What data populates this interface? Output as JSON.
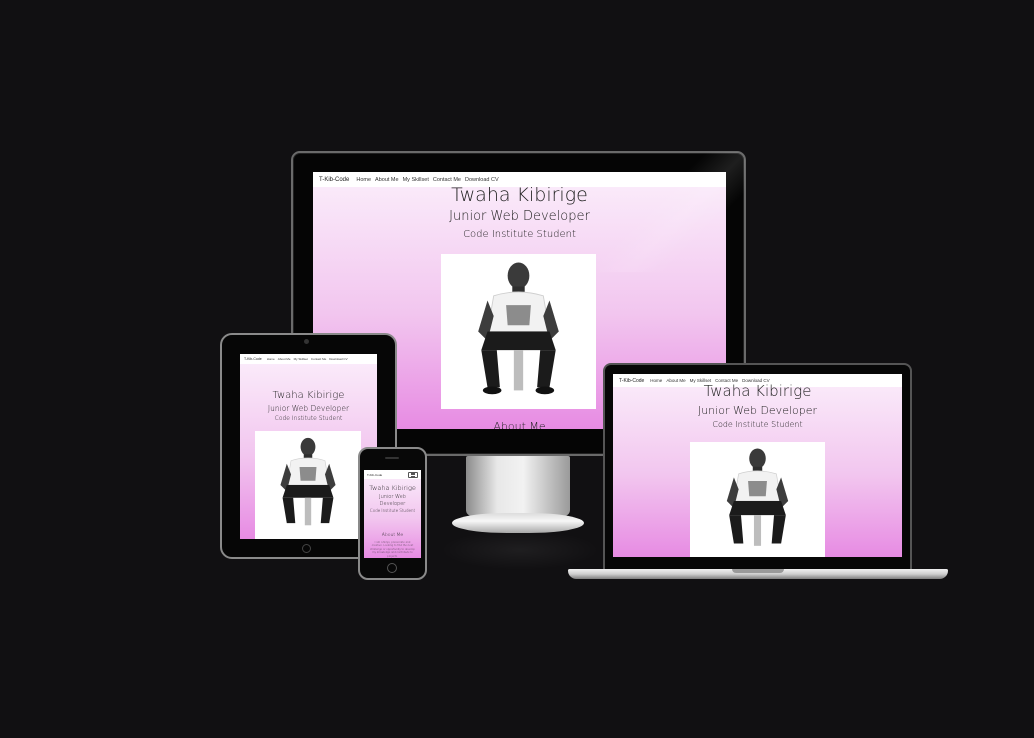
{
  "site": {
    "brand": "T-Kib-Code",
    "nav_links": [
      "Home",
      "About Me",
      "My Skillset",
      "Contact Me",
      "Download CV"
    ],
    "hero_name": "Twaha Kibirige",
    "hero_role": "Junior Web Developer",
    "hero_sub": "Code Institute Student",
    "about_title": "About Me",
    "about_text": "I am a Ninja, passionate and creative. Looking to find the next challenge or opportunity to develop my knowledge and contribute to projects."
  },
  "devices": [
    "monitor",
    "laptop",
    "tablet",
    "phone"
  ],
  "colors": {
    "background": "#111012",
    "gradient_top": "#fbeefb",
    "gradient_bottom": "#e78be3"
  },
  "icons": {
    "menu": "hamburger-icon"
  }
}
